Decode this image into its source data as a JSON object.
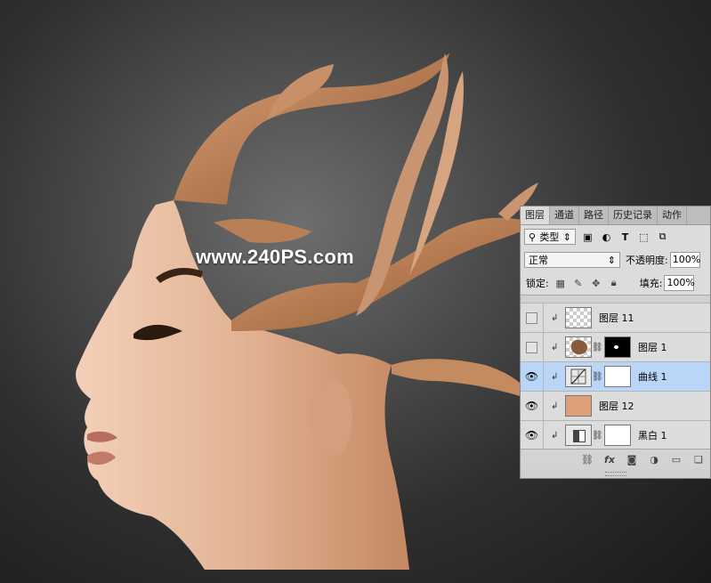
{
  "watermark": "www.240PS.com",
  "panel": {
    "tabs": [
      "图层",
      "通道",
      "路径",
      "历史记录",
      "动作"
    ],
    "filter": {
      "label": "类型",
      "prefix_icon": "search-icon"
    },
    "blend_mode": "正常",
    "opacity": {
      "label": "不透明度:",
      "value": "100%"
    },
    "lock": {
      "label": "锁定:"
    },
    "fill": {
      "label": "填充:",
      "value": "100%"
    },
    "layers": [
      {
        "name": "图层 11",
        "visible": false,
        "thumb": "transparent",
        "clipped": true
      },
      {
        "name": "图层 1",
        "visible": false,
        "thumb": "photo",
        "mask": "black",
        "clipped": true
      },
      {
        "name": "曲线 1",
        "visible": true,
        "thumb": "curves-adjustment",
        "mask": "white",
        "clipped": true,
        "selected": true
      },
      {
        "name": "图层 12",
        "visible": true,
        "thumb": "color",
        "thumb_color": "#dca17a",
        "clipped": true
      },
      {
        "name": "黑白 1",
        "visible": true,
        "thumb": "bw-adjustment",
        "mask": "white",
        "clipped": true
      }
    ],
    "footer_icons": [
      "link-icon",
      "fx-icon",
      "mask-icon",
      "adjustment-icon",
      "folder-icon",
      "new-layer-icon"
    ]
  },
  "colors": {
    "skin": "#e2b394",
    "splash": "#c18a5f",
    "selection": "#b9d6f8"
  }
}
